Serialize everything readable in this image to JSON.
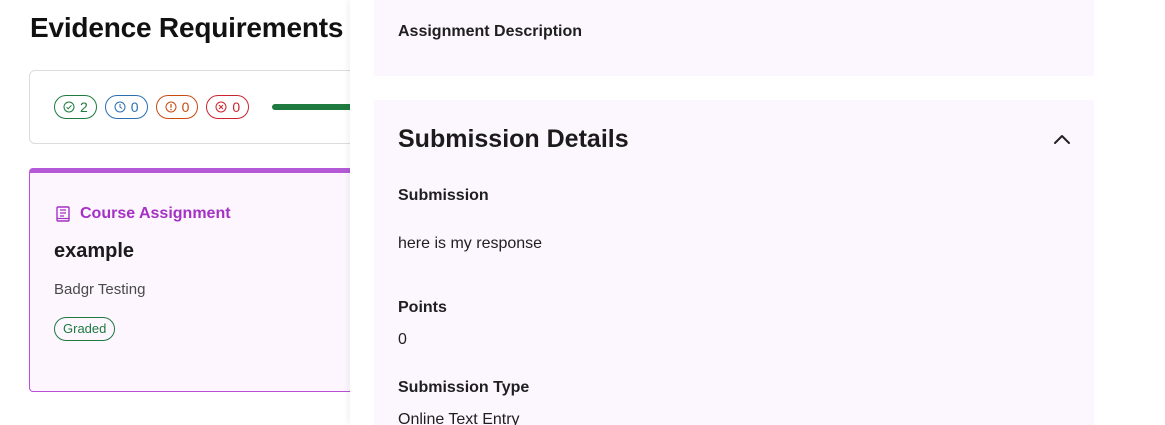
{
  "page": {
    "title": "Evidence Requirements"
  },
  "summary": {
    "badges": [
      {
        "icon": "check-circle-icon",
        "count": "2",
        "color": "#1e7a3e"
      },
      {
        "icon": "clock-icon",
        "count": "0",
        "color": "#2a6fb0"
      },
      {
        "icon": "alert-circle-icon",
        "count": "0",
        "color": "#c94a0f"
      },
      {
        "icon": "x-circle-icon",
        "count": "0",
        "color": "#c8252f"
      }
    ],
    "progress_fraction": 1.0
  },
  "assignment_card": {
    "type_label": "Course Assignment",
    "type_icon": "book-icon",
    "title": "example",
    "organization": "Badgr Testing",
    "status": "Graded",
    "accent": "#b45ad6"
  },
  "drawer": {
    "description_label": "Assignment Description",
    "submission_section": {
      "title": "Submission Details",
      "toggle_icon": "chevron-up-icon",
      "submission_label": "Submission",
      "submission_value": "here is my response",
      "points_label": "Points",
      "points_value": "0",
      "type_label": "Submission Type",
      "type_value": "Online Text Entry"
    }
  }
}
